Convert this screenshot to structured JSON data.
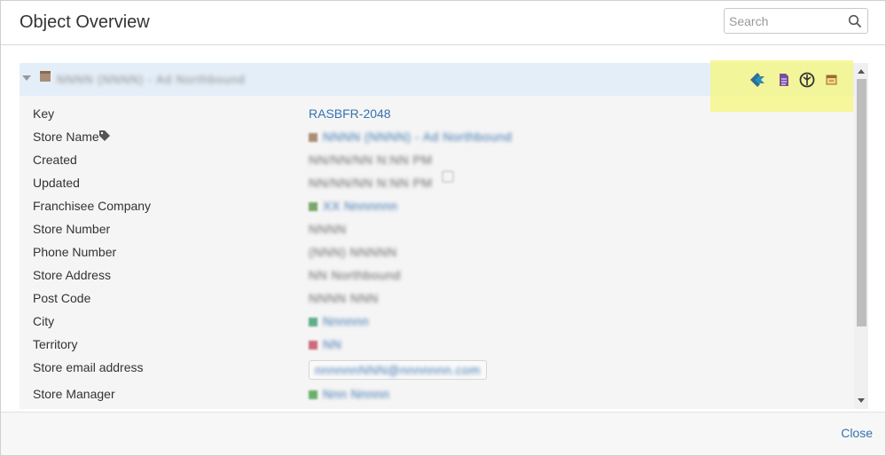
{
  "dialog": {
    "title": "Object Overview",
    "search_placeholder": "Search",
    "close_label": "Close"
  },
  "object": {
    "name": "NNNN (NNNN) - Ad Northbound",
    "toolbar_icons": [
      "jira-issue-icon",
      "document-icon",
      "graph-icon",
      "calendar-icon"
    ]
  },
  "attributes": [
    {
      "label": "Key",
      "value": "RASBFR-2048",
      "style": "link"
    },
    {
      "label": "Store Name",
      "value": "NNNN (NNNN) - Ad Northbound",
      "style": "blur-link",
      "tag": true,
      "icon": "#a98e76"
    },
    {
      "label": "Created",
      "value": "NN/NN/NN N:NN PM",
      "style": "blur"
    },
    {
      "label": "Updated",
      "value": "NN/NN/NN N:NN PM",
      "style": "blur"
    },
    {
      "label": "Franchisee Company",
      "value": "XX Nnnnnnn",
      "style": "blur-link",
      "icon": "#7aa86a"
    },
    {
      "label": "Store Number",
      "value": "NNNN",
      "style": "blur"
    },
    {
      "label": "Phone Number",
      "value": "(NNN) NNNNN",
      "style": "blur"
    },
    {
      "label": "Store Address",
      "value": "NN Northbound",
      "style": "blur"
    },
    {
      "label": "Post Code",
      "value": "NNNN NNN",
      "style": "blur"
    },
    {
      "label": "City",
      "value": "Nnnnnn",
      "style": "blur-link",
      "icon": "#5fae8a"
    },
    {
      "label": "Territory",
      "value": "NN",
      "style": "blur-link",
      "icon": "#d06a7a"
    },
    {
      "label": "Store email address",
      "value": "nnnnnnNNN@nnnnnnn.com",
      "style": "blur-link",
      "pill": true
    },
    {
      "label": "Store Manager",
      "value": "Nnn Nnnnn",
      "style": "blur-link",
      "icon": "#6ab06a"
    }
  ],
  "colors": {
    "accent_link": "#3572b0",
    "highlight": "#f6f68a",
    "object_header_bg": "#e4eef8"
  }
}
